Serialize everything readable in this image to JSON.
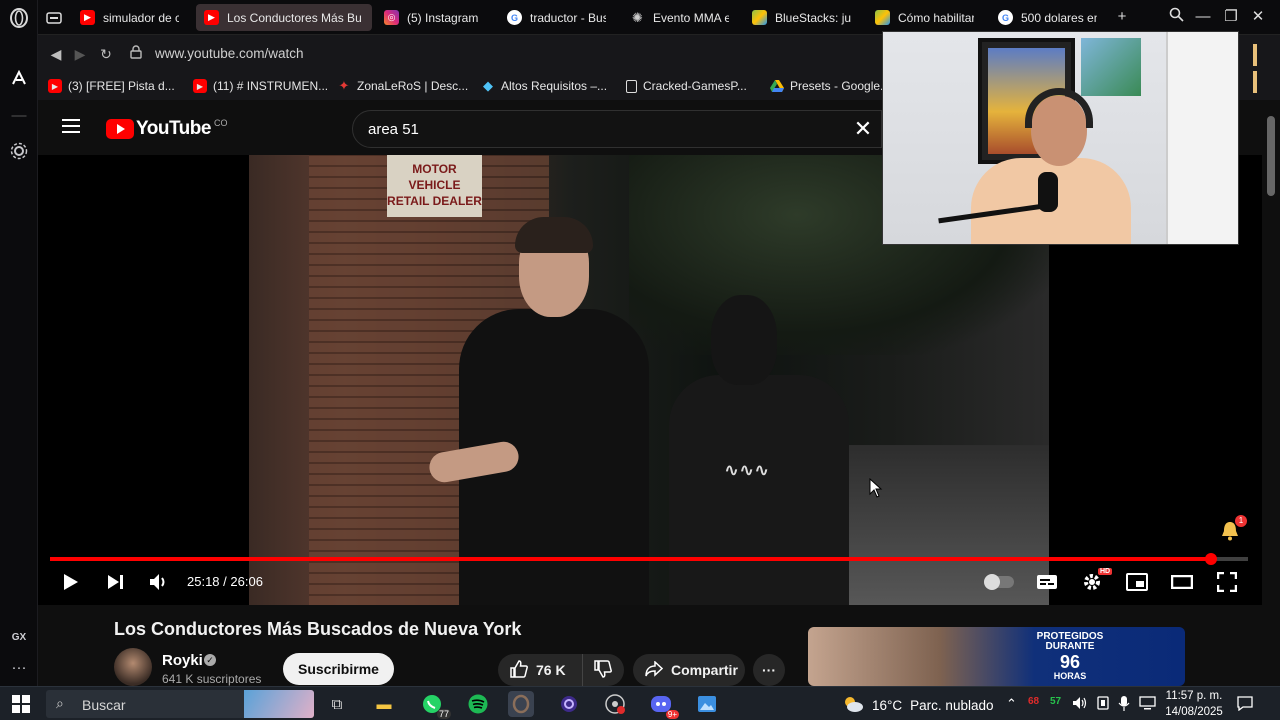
{
  "browser": {
    "tabs": [
      {
        "label": "simulador de c",
        "favicon_color": "#ff0000",
        "active": false
      },
      {
        "label": "Los Conductores Más Bu",
        "favicon_color": "#ff0000",
        "active": true
      },
      {
        "label": "(5) Instagram",
        "favicon_color": "#d6249f",
        "active": false
      },
      {
        "label": "traductor - Bus",
        "favicon_color": "#4285f4",
        "active": false
      },
      {
        "label": "Evento MMA e",
        "favicon_color": "#888888",
        "active": false
      },
      {
        "label": "BlueStacks: jue",
        "favicon_color": "#8bc34a",
        "active": false
      },
      {
        "label": "Cómo habilitar",
        "favicon_color": "#8bc34a",
        "active": false
      },
      {
        "label": "500 dolares en",
        "favicon_color": "#4285f4",
        "active": false
      }
    ],
    "url": "www.youtube.com/watch",
    "bookmarks": [
      {
        "label": "(3) [FREE] Pista d...",
        "color": "#ff0000"
      },
      {
        "label": "(11) # INSTRUMEN...",
        "color": "#ff0000"
      },
      {
        "label": "ZonaLeRoS | Desc...",
        "color": "#e53935"
      },
      {
        "label": "Altos Requisitos –...",
        "color": "#4fc3f7"
      },
      {
        "label": "Cracked-GamesP...",
        "color": "#dddddd"
      },
      {
        "label": "Presets - Google...",
        "color": "#fbbc04"
      }
    ],
    "sidebar_label": "GX"
  },
  "youtube": {
    "logo_text": "YouTube",
    "country_code": "CO",
    "search_query": "area 51",
    "player": {
      "sign_text": "MOTOR VEHICLE RETAIL DEALER",
      "time_current": "25:18",
      "time_total": "26:06",
      "progress_fraction": 0.969,
      "hd_label": "HD",
      "bell_count": "1"
    },
    "video_title": "Los Conductores Más Buscados de Nueva York",
    "channel": {
      "name": "Royki",
      "subscribers": "641 K suscriptores",
      "subscribe_label": "Suscribirme"
    },
    "likes": "76 K",
    "share_label": "Compartir",
    "more_label": "···",
    "ad": {
      "line1": "PROTEGIDOS",
      "line2": "DURANTE",
      "line3": "96",
      "line4": "HORAS"
    }
  },
  "taskbar": {
    "search_placeholder": "Buscar",
    "whatsapp_badge": "77",
    "discord_badge": "9+",
    "temperature": "16°C",
    "weather": "Parc. nublado",
    "tray_num1": "68",
    "tray_num2": "57",
    "time": "11:57 p. m.",
    "date": "14/08/2025"
  }
}
